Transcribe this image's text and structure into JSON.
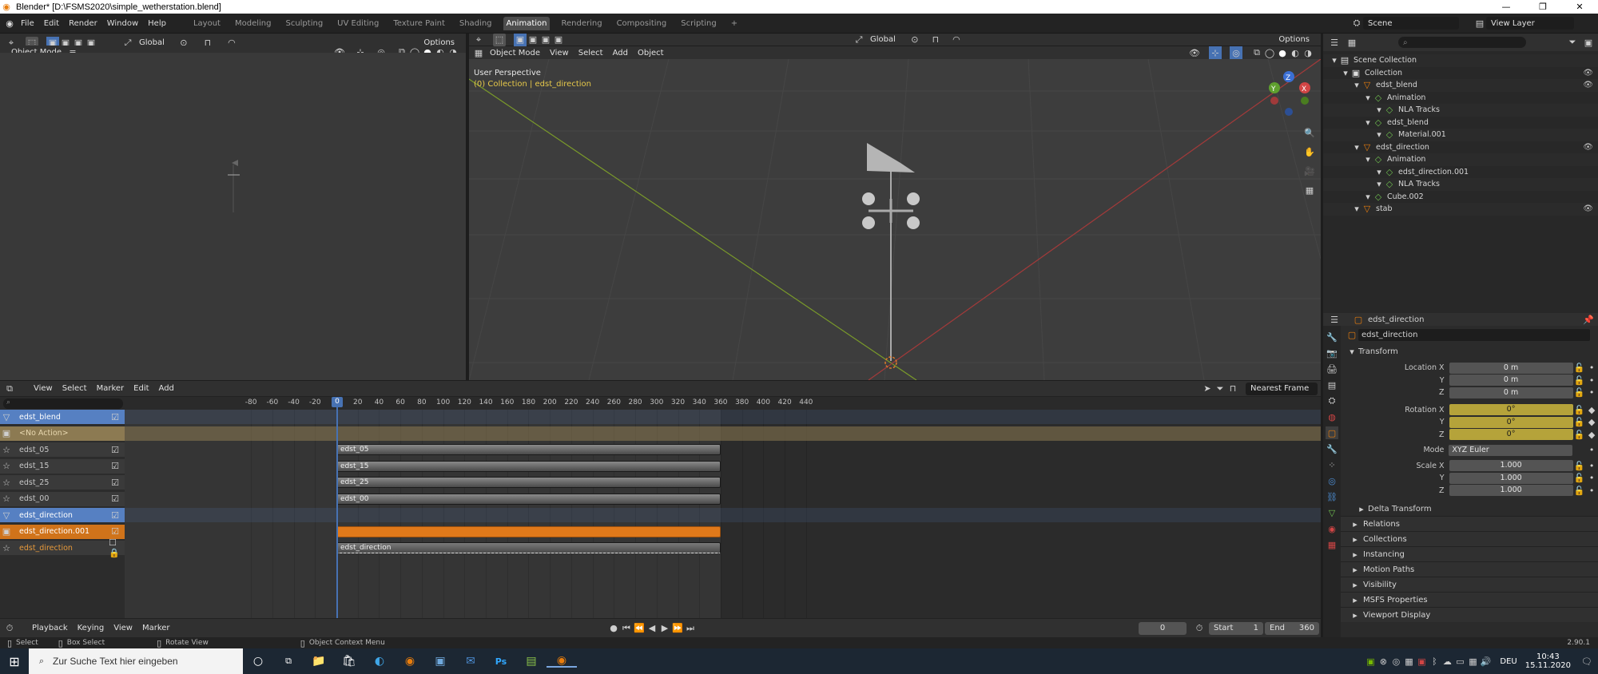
{
  "window": {
    "title": "Blender* [D:\\FSMS2020\\simple_wetherstation.blend]",
    "controls": [
      "—",
      "❐",
      "✕"
    ]
  },
  "menu": {
    "items": [
      "File",
      "Edit",
      "Render",
      "Window",
      "Help"
    ],
    "workspaces": [
      "Layout",
      "Modeling",
      "Sculpting",
      "UV Editing",
      "Texture Paint",
      "Shading",
      "Animation",
      "Rendering",
      "Compositing",
      "Scripting"
    ],
    "active_workspace": "Animation",
    "add_tab": "+",
    "scene": "Scene",
    "view_layer": "View Layer"
  },
  "left_view": {
    "transform_orientation": "Global",
    "options": "Options",
    "mode": "Object Mode"
  },
  "viewport": {
    "transform_orientation": "Global",
    "options": "Options",
    "mode": "Object Mode",
    "menus": [
      "View",
      "Select",
      "Add",
      "Object"
    ],
    "info_title": "User Perspective",
    "info_sub": "(0) Collection | edst_direction",
    "gizmo": {
      "x": "X",
      "y": "Y",
      "z": "Z"
    }
  },
  "outliner": {
    "search_placeholder": "",
    "rows": [
      {
        "indent": 0,
        "label": "Scene Collection",
        "eye": false
      },
      {
        "indent": 1,
        "label": "Collection",
        "eye": true
      },
      {
        "indent": 2,
        "label": "edst_blend",
        "eye": true
      },
      {
        "indent": 3,
        "label": "Animation",
        "eye": false
      },
      {
        "indent": 4,
        "label": "NLA Tracks",
        "eye": false
      },
      {
        "indent": 3,
        "label": "edst_blend",
        "eye": false
      },
      {
        "indent": 4,
        "label": "Material.001",
        "eye": false
      },
      {
        "indent": 2,
        "label": "edst_direction",
        "eye": true
      },
      {
        "indent": 3,
        "label": "Animation",
        "eye": false
      },
      {
        "indent": 4,
        "label": "edst_direction.001",
        "eye": false
      },
      {
        "indent": 4,
        "label": "NLA Tracks",
        "eye": false
      },
      {
        "indent": 3,
        "label": "Cube.002",
        "eye": false
      },
      {
        "indent": 2,
        "label": "stab",
        "eye": true
      }
    ]
  },
  "properties": {
    "object_name": "edst_direction",
    "object_field": "edst_direction",
    "transform_title": "Transform",
    "location": {
      "label": "Location X",
      "x": "0 m",
      "y": "0 m",
      "z": "0 m"
    },
    "rotation": {
      "label": "Rotation X",
      "x": "0°",
      "y": "0°",
      "z": "0°"
    },
    "mode_label": "Mode",
    "mode_value": "XYZ Euler",
    "scale": {
      "label": "Scale X",
      "x": "1.000",
      "y": "1.000",
      "z": "1.000"
    },
    "axis_y": "Y",
    "axis_z": "Z",
    "subpanel": "Delta Transform",
    "panels": [
      "Relations",
      "Collections",
      "Instancing",
      "Motion Paths",
      "Visibility",
      "MSFS Properties",
      "Viewport Display"
    ]
  },
  "nla": {
    "menus": [
      "View",
      "Select",
      "Marker",
      "Edit",
      "Add"
    ],
    "snap": "Nearest Frame",
    "ruler": [
      "-80",
      "-60",
      "-40",
      "-20",
      "0",
      "20",
      "40",
      "60",
      "80",
      "100",
      "120",
      "140",
      "160",
      "180",
      "200",
      "220",
      "240",
      "260",
      "280",
      "300",
      "320",
      "340",
      "360",
      "380",
      "400",
      "420",
      "440"
    ],
    "current_frame": "0",
    "tracks": [
      {
        "label": "edst_blend",
        "kind": "object"
      },
      {
        "label": "<No Action>",
        "kind": "action"
      },
      {
        "label": "edst_05",
        "kind": "track"
      },
      {
        "label": "edst_15",
        "kind": "track"
      },
      {
        "label": "edst_25",
        "kind": "track"
      },
      {
        "label": "edst_00",
        "kind": "track"
      },
      {
        "label": "edst_direction",
        "kind": "object"
      },
      {
        "label": "edst_direction.001",
        "kind": "active"
      },
      {
        "label": "edst_direction",
        "kind": "track2"
      }
    ],
    "strips": [
      "edst_05",
      "edst_15",
      "edst_25",
      "edst_00",
      "",
      "",
      "edst_direction"
    ]
  },
  "timeline": {
    "menus": [
      "Playback",
      "Keying",
      "View",
      "Marker"
    ],
    "frame": "0",
    "start_label": "Start",
    "start": "1",
    "end_label": "End",
    "end": "360"
  },
  "statusbar": {
    "select": "Select",
    "box_select": "Box Select",
    "rotate_view": "Rotate View",
    "context_menu": "Object Context Menu",
    "version": "2.90.1"
  },
  "taskbar": {
    "search_placeholder": "Zur Suche Text hier eingeben",
    "lang": "DEU",
    "time": "10:43",
    "date": "15.11.2020"
  }
}
